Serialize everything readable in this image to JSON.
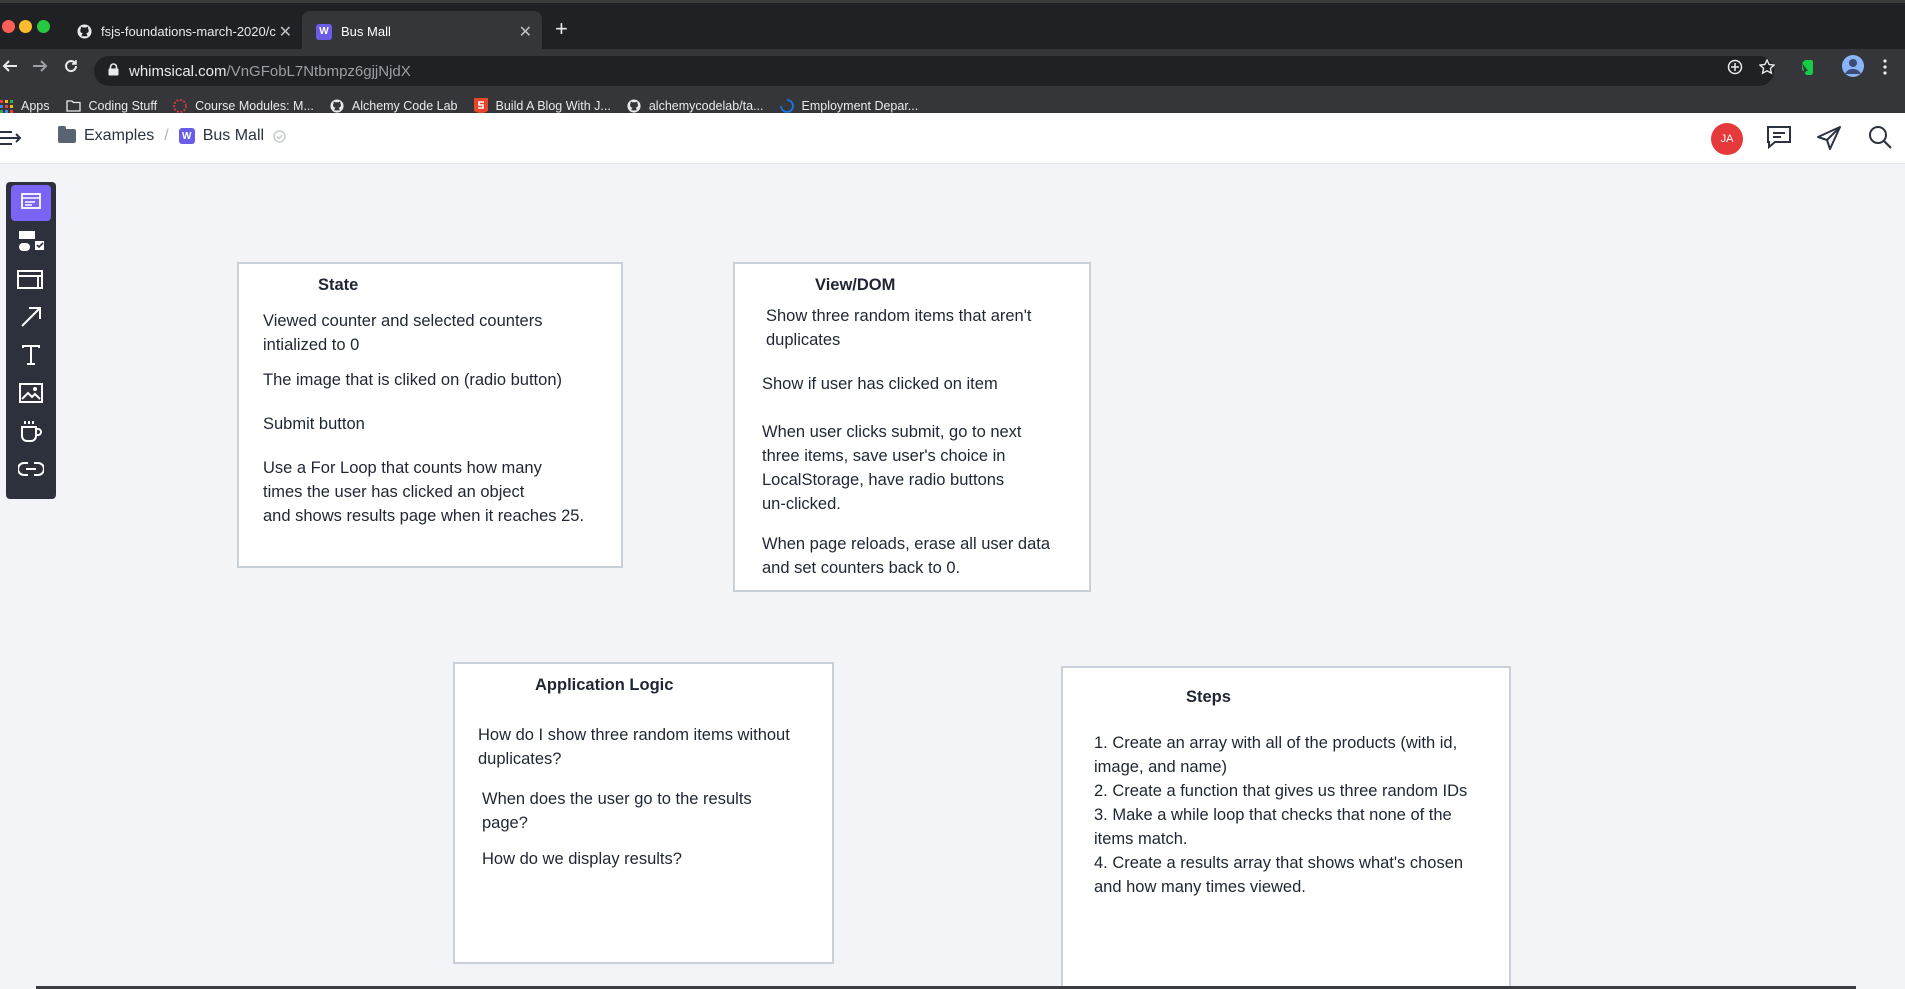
{
  "browser": {
    "tabs": [
      {
        "title": "fsjs-foundations-march-2020/c",
        "icon": "github-icon"
      },
      {
        "title": "Bus Mall",
        "icon": "whimsical-icon",
        "badge": "W"
      }
    ],
    "new_tab": "+",
    "close_glyph": "✕",
    "url_host": "whimsical.com",
    "url_path": "/VnGFobL7Ntbmpz6gjjNjdX",
    "bookmarks": [
      {
        "label": "Apps",
        "icon": "apps-grid-icon"
      },
      {
        "label": "Coding Stuff",
        "icon": "folder-icon"
      },
      {
        "label": "Course Modules: M...",
        "icon": "canvas-icon"
      },
      {
        "label": "Alchemy Code Lab",
        "icon": "github-icon"
      },
      {
        "label": "Build A Blog With J...",
        "icon": "bookmark-s-icon"
      },
      {
        "label": "alchemycodelab/ta...",
        "icon": "github-icon"
      },
      {
        "label": "Employment Depar...",
        "icon": "spinner-icon"
      }
    ]
  },
  "header": {
    "breadcrumb": {
      "folder": "Examples",
      "separator": "/",
      "board": "Bus Mall",
      "board_badge": "W"
    },
    "avatar_initials": "JA",
    "icons": [
      "comment-icon",
      "send-icon",
      "search-icon"
    ]
  },
  "palette": {
    "tools": [
      "card-icon",
      "flowchart-icon",
      "wireframe-icon",
      "arrow-icon",
      "text-icon",
      "image-icon",
      "sticky-cup-icon",
      "link-icon"
    ]
  },
  "cards": {
    "state": {
      "title": "State",
      "items": [
        "Viewed counter and selected counters\nintialized to 0",
        "The image that is cliked on (radio button)",
        "Submit button",
        "Use a For Loop that counts how many\ntimes the user has clicked an object\nand shows results page when it reaches 25."
      ]
    },
    "view": {
      "title": "View/DOM",
      "items": [
        "Show three random items that aren't\nduplicates",
        "Show if user has clicked on item",
        "When user clicks submit, go to next\nthree items, save user's choice in\nLocalStorage, have radio buttons\nun-clicked.",
        "When page reloads, erase all user data\nand set counters back to 0."
      ]
    },
    "logic": {
      "title": "Application Logic",
      "items": [
        "How do I show three random items without\nduplicates?",
        "When does the user go to the results\npage?",
        "How do we display results?"
      ]
    },
    "steps": {
      "title": "Steps",
      "items": [
        "1. Create an array with all of the products (with id,\nimage, and name)\n2. Create a function that gives us three random IDs\n3. Make a while loop that checks that none of the\nitems match.\n4. Create a results array that shows what's chosen\nand how many times viewed."
      ]
    }
  },
  "colors": {
    "accent": "#7a64f4",
    "avatar": "#e5393c",
    "card_border": "#c9d0d9",
    "canvas": "#f2f4f7"
  }
}
